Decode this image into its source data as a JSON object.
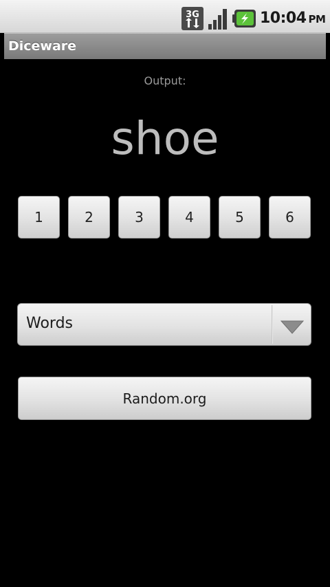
{
  "status_bar": {
    "network_type": "3G",
    "time": "10:04",
    "ampm": "PM",
    "icons": [
      "3g-data-icon",
      "signal-icon",
      "battery-charging-icon"
    ]
  },
  "title_bar": {
    "title": "Diceware"
  },
  "output": {
    "label": "Output:",
    "value": "shoe"
  },
  "dice": {
    "buttons": [
      "1",
      "2",
      "3",
      "4",
      "5",
      "6"
    ]
  },
  "list_selector": {
    "selected": "Words",
    "icon": "dropdown-arrow-icon"
  },
  "random_button": {
    "label": "Random.org"
  },
  "colors": {
    "background": "#000000",
    "title_bar": "#8a8a8a",
    "output_text": "#bdbdbd",
    "button_face": "#e4e4e4",
    "battery_green": "#5cc23a"
  }
}
